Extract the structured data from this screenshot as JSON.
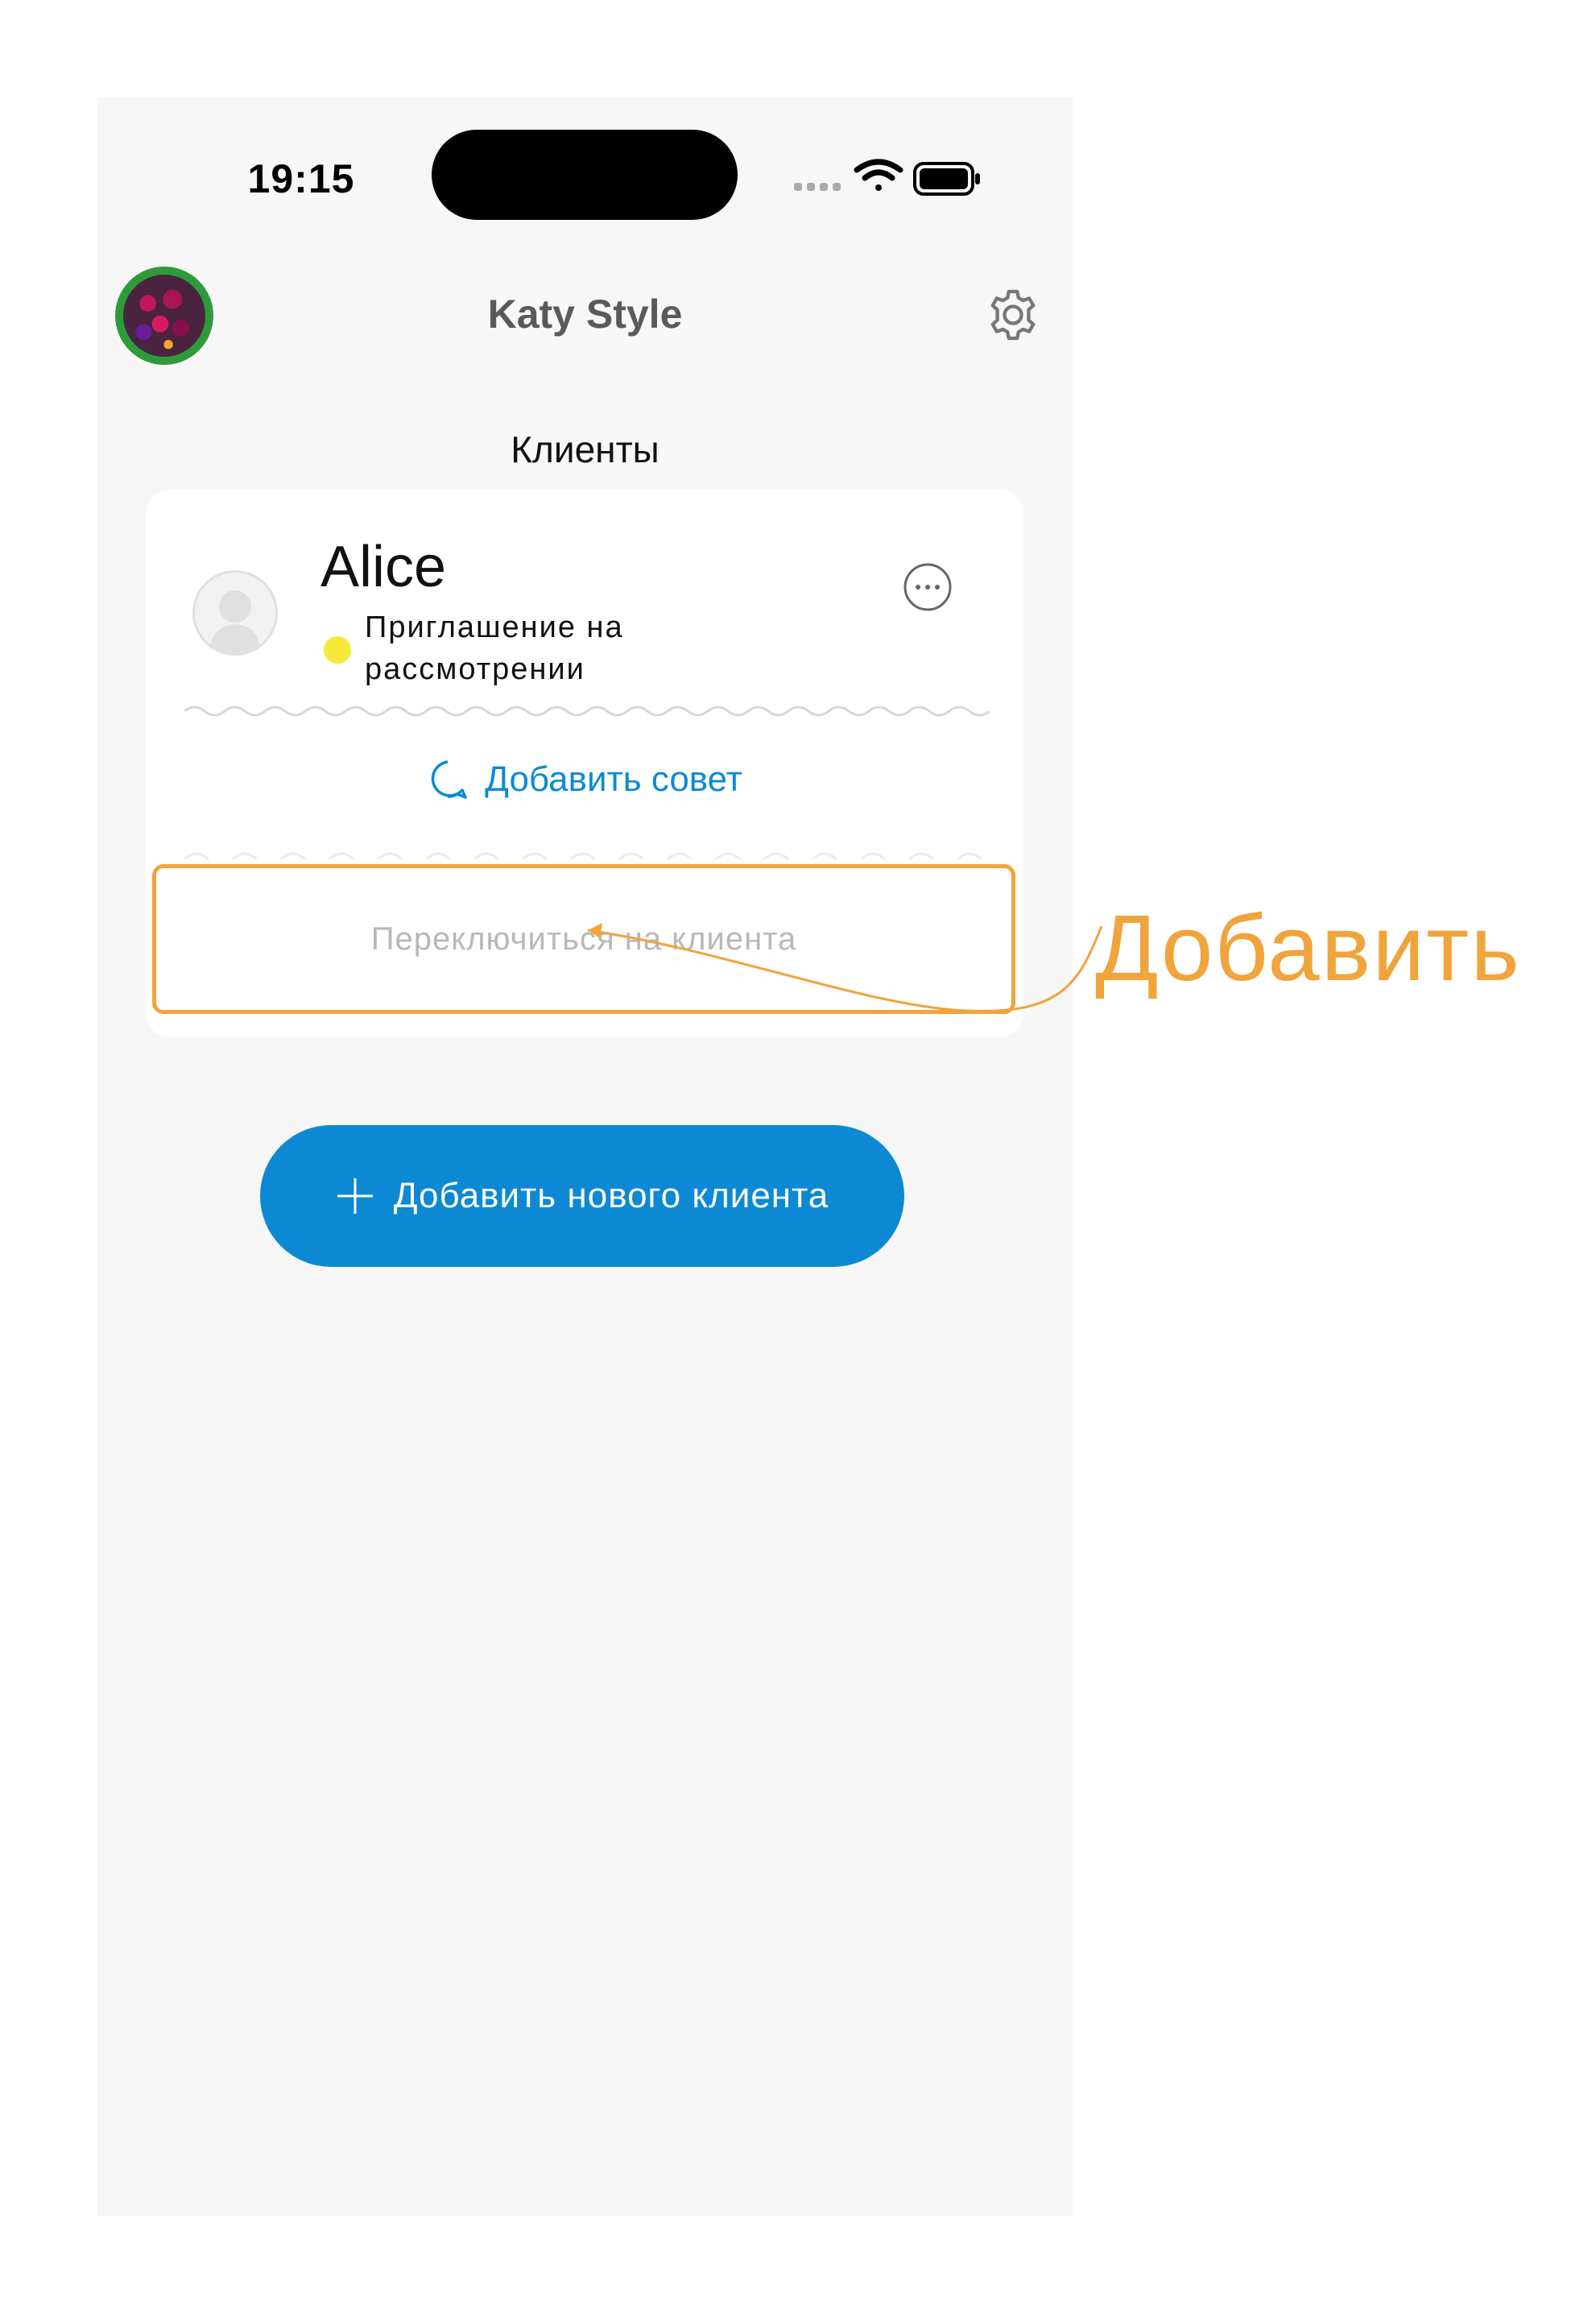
{
  "status_bar": {
    "time": "19:15"
  },
  "header": {
    "title": "Katy Style",
    "avatar_icon": "profile-photo",
    "settings_icon": "gear-icon"
  },
  "section": {
    "title": "Клиенты"
  },
  "client_card": {
    "name": "Alice",
    "status_line1": "Приглашение на",
    "status_line2": "рассмотрении",
    "status_color": "#f5e93a",
    "add_advice_label": "Добавить совет",
    "switch_label": "Переключиться на клиента"
  },
  "annotation": {
    "label": "Добавить",
    "color": "#f0a43c"
  },
  "actions": {
    "add_client_label": "Добавить нового клиента",
    "accent": "#0c89d2"
  }
}
